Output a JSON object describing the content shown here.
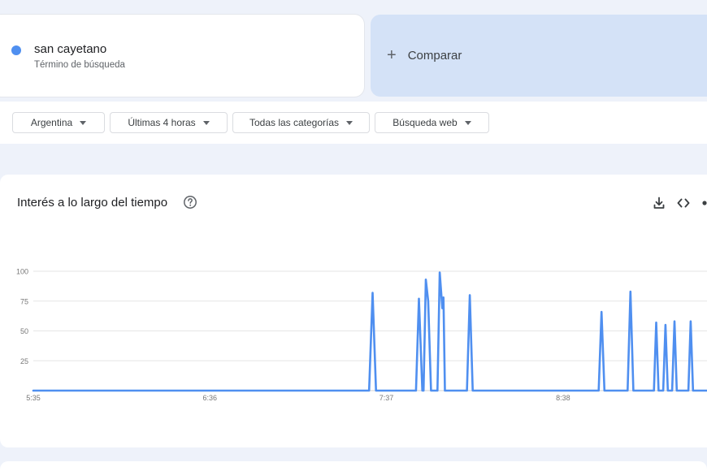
{
  "search_term": {
    "name": "san cayetano",
    "subtitle": "Término de búsqueda",
    "color": "#4f8ff0"
  },
  "compare": {
    "icon": "plus-icon",
    "label": "Comparar"
  },
  "filters": [
    {
      "label": "Argentina"
    },
    {
      "label": "Últimas 4 horas"
    },
    {
      "label": "Todas las categorías"
    },
    {
      "label": "Búsqueda web"
    }
  ],
  "chart_panel": {
    "title": "Interés a lo largo del tiempo",
    "icons": [
      "help-icon",
      "download-icon",
      "embed-icon",
      "share-icon"
    ]
  },
  "chart_data": {
    "type": "line",
    "title": "",
    "xlabel": "",
    "ylabel": "",
    "ylim": [
      0,
      100
    ],
    "yticks": [
      25,
      50,
      75,
      100
    ],
    "xticks": [
      "5:35",
      "6:36",
      "7:37",
      "8:38"
    ],
    "x_tick_minutes": [
      0,
      61,
      122,
      183
    ],
    "grid": true,
    "series": [
      {
        "color": "#4f8ff0",
        "points": [
          [
            0,
            0
          ],
          [
            116,
            0
          ],
          [
            117.2,
            82
          ],
          [
            118.4,
            0
          ],
          [
            132.2,
            0
          ],
          [
            133.2,
            77
          ],
          [
            134.4,
            0
          ],
          [
            134.8,
            0
          ],
          [
            135.6,
            93
          ],
          [
            136.4,
            75
          ],
          [
            137.4,
            0
          ],
          [
            139.6,
            0
          ],
          [
            140.4,
            99
          ],
          [
            141.3,
            69
          ],
          [
            141.7,
            78
          ],
          [
            142.2,
            0
          ],
          [
            149.8,
            0
          ],
          [
            150.8,
            80
          ],
          [
            151.8,
            0
          ],
          [
            195.3,
            0
          ],
          [
            196.3,
            66
          ],
          [
            197.3,
            0
          ],
          [
            205.3,
            0
          ],
          [
            206.3,
            83
          ],
          [
            207.3,
            0
          ],
          [
            214.4,
            0
          ],
          [
            215.2,
            57
          ],
          [
            216.0,
            0
          ],
          [
            217.6,
            0
          ],
          [
            218.4,
            55
          ],
          [
            219.2,
            0
          ],
          [
            220.7,
            0
          ],
          [
            221.5,
            58
          ],
          [
            222.3,
            0
          ],
          [
            226.3,
            0
          ],
          [
            227.1,
            58
          ],
          [
            227.9,
            0
          ],
          [
            235,
            0
          ]
        ]
      }
    ]
  }
}
